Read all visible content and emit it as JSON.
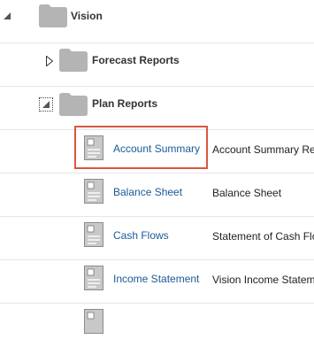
{
  "tree": {
    "root": {
      "label": "Vision",
      "icon": "folder-icon",
      "state": "expanded"
    },
    "folders": [
      {
        "label": "Forecast Reports",
        "icon": "folder-icon",
        "state": "collapsed"
      },
      {
        "label": "Plan Reports",
        "icon": "folder-icon",
        "state": "expanded"
      }
    ],
    "reports": [
      {
        "name": "Account Summary",
        "description": "Account Summary Re",
        "icon": "report-document-icon"
      },
      {
        "name": "Balance Sheet",
        "description": "Balance Sheet",
        "icon": "report-document-icon"
      },
      {
        "name": "Cash Flows",
        "description": "Statement of Cash Flo",
        "icon": "report-document-icon"
      },
      {
        "name": "Income Statement",
        "description": "Vision Income Statem",
        "icon": "report-document-icon"
      }
    ]
  },
  "colors": {
    "link": "#1a5a96",
    "highlight": "#d9573f",
    "folder": "#b4b4b4",
    "row_divider": "#e6e6e6"
  }
}
